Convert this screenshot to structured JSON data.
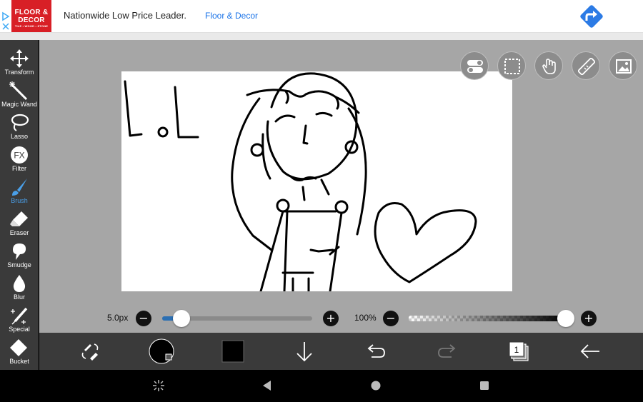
{
  "ad": {
    "logo_line1": "FLOOR & DECOR",
    "logo_line2": "TILE • WOOD • STONE",
    "headline": "Nationwide Low Price Leader.",
    "brand": "Floor & Decor",
    "icons": [
      "adchoices-icon",
      "directions-arrow-icon"
    ],
    "colors": {
      "logo_red": "#d81f26",
      "brand_blue": "#1a73e8",
      "cta_blue": "#2c7be5"
    }
  },
  "toolbar": {
    "tools": [
      {
        "label": "Transform",
        "icon": "move-arrows-icon",
        "active": false
      },
      {
        "label": "Magic Wand",
        "icon": "magic-wand-icon",
        "active": false
      },
      {
        "label": "Lasso",
        "icon": "lasso-icon",
        "active": false
      },
      {
        "label": "Filter",
        "icon": "fx-icon",
        "active": false
      },
      {
        "label": "Brush",
        "icon": "brush-icon",
        "active": true
      },
      {
        "label": "Eraser",
        "icon": "eraser-icon",
        "active": false
      },
      {
        "label": "Smudge",
        "icon": "smudge-icon",
        "active": false
      },
      {
        "label": "Blur",
        "icon": "blur-drop-icon",
        "active": false
      },
      {
        "label": "Special",
        "icon": "special-pen-icon",
        "active": false
      },
      {
        "label": "Bucket",
        "icon": "bucket-icon",
        "active": false
      }
    ],
    "active_color": "#4a9fe8"
  },
  "top_buttons": [
    "toggle-icon",
    "selection-icon",
    "hand-icon",
    "ruler-icon",
    "image-icon"
  ],
  "brush": {
    "size_label": "5.0px",
    "size_level": 0.13,
    "opacity_label": "100%",
    "opacity_level": 1.0
  },
  "bottom_bar": {
    "icons": [
      "swap-tools-icon",
      "brush-preview-icon",
      "color-swatch-icon",
      "download-icon",
      "undo-icon",
      "redo-icon",
      "layers-icon",
      "back-arrow-icon"
    ],
    "layers_count": "1",
    "color": "#000000"
  },
  "android_nav": [
    "assistant-icon",
    "back-icon",
    "home-icon",
    "recents-icon"
  ]
}
